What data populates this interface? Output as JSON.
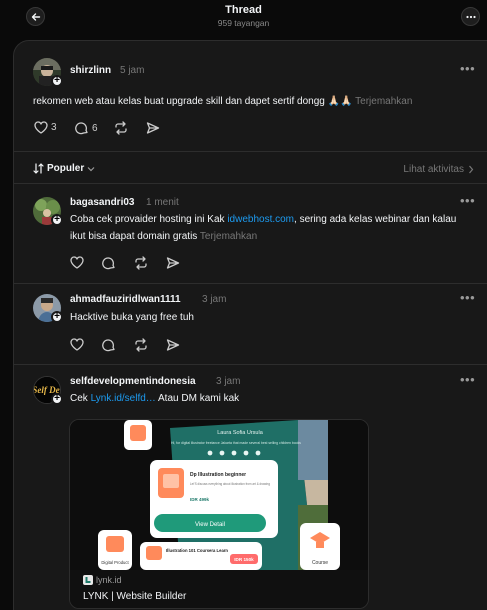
{
  "header": {
    "title": "Thread",
    "views": "959 tayangan"
  },
  "main_post": {
    "username": "shirzlinn",
    "time": "5 jam",
    "text": "rekomen web atau kelas buat upgrade skill dan dapet sertif dongg 🙏🏻🙏🏻",
    "translate": "Terjemahkan",
    "likes": "3",
    "replies": "6"
  },
  "sort": {
    "label": "Populer",
    "activity": "Lihat aktivitas"
  },
  "replies": [
    {
      "username": "bagasandri03",
      "time": "1 menit",
      "text_before": "Coba cek provaider hosting ini Kak ",
      "link": "idwebhost.com",
      "text_after": ", sering ada kelas webinar dan kalau ikut bisa dapat domain gratis",
      "translate": "Terjemahkan"
    },
    {
      "username": "ahmadfauziridlwan1111",
      "time": "3 jam",
      "text": "Hacktive buka yang free tuh"
    },
    {
      "username": "selfdevelopmentindonesia",
      "time": "3 jam",
      "text_before": "Cek ",
      "link": "Lynk.id/selfd…",
      "text_after": " Atau DM kami kak",
      "avatar_text": "Self Dev",
      "preview": {
        "domain": "lynk.id",
        "title": "LYNK | Website Builder",
        "profile_name": "Laura Sofia Ursula",
        "profile_bio": "Hi, for digital illustrator freelance Jakarta that made several best selling children books",
        "card1_title": "Dp Illustration beginner",
        "card1_desc": "Let'S discuss everything about illustration from art & drawing",
        "card1_price": "IDR 499k",
        "cta": "View Detail",
        "card2_title": "Illustration 101 Coursera Learn",
        "card2_price": "IDR 150k",
        "label_left": "Digital Product",
        "label_right": "Course"
      }
    }
  ],
  "colors": {
    "background": "#0a0a0a",
    "panel": "#181818",
    "border": "#2d2d2d",
    "link": "#1d9bf0",
    "lynk_green": "#1f7a6b",
    "lynk_orange": "#ff8a5b"
  }
}
